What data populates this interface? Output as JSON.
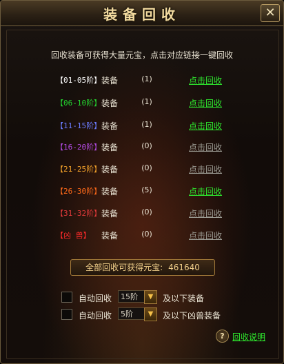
{
  "title": "装备回收",
  "close_icon": "close-x-icon",
  "intro": "回收装备可获得大量元宝，点击对应链接一键回收",
  "tier_word": "装备",
  "rows": [
    {
      "tier": "【01-05阶】",
      "tier_color": "#ffffff",
      "count": "(1)",
      "link": "点击回收",
      "active": true
    },
    {
      "tier": "【06-10阶】",
      "tier_color": "#23d12e",
      "count": "(1)",
      "link": "点击回收",
      "active": true
    },
    {
      "tier": "【11-15阶】",
      "tier_color": "#6b7cff",
      "count": "(1)",
      "link": "点击回收",
      "active": true
    },
    {
      "tier": "【16-20阶】",
      "tier_color": "#b04ae0",
      "count": "(0)",
      "link": "点击回收",
      "active": false
    },
    {
      "tier": "【21-25阶】",
      "tier_color": "#f0a02a",
      "count": "(0)",
      "link": "点击回收",
      "active": false
    },
    {
      "tier": "【26-30阶】",
      "tier_color": "#ff6a1a",
      "count": "(5)",
      "link": "点击回收",
      "active": true
    },
    {
      "tier": "【31-32阶】",
      "tier_color": "#e23a3a",
      "count": "(0)",
      "link": "点击回收",
      "active": false
    },
    {
      "tier": "【凶  兽】",
      "tier_color": "#ff2a2a",
      "count": "(0)",
      "link": "点击回收",
      "active": false
    }
  ],
  "total": {
    "label": "全部回收可获得元宝:",
    "value": "461640"
  },
  "options": [
    {
      "label": "自动回收",
      "select_value": "15阶",
      "suffix": "及以下装备",
      "checked": false
    },
    {
      "label": "自动回收",
      "select_value": "5阶",
      "suffix": "及以下凶兽装备",
      "checked": false
    }
  ],
  "help": {
    "icon": "question-mark-icon",
    "label": "回收说明"
  },
  "colors": {
    "link_active": "#2ee82e",
    "link_inactive": "#9a9a92",
    "title": "#f3dba0"
  }
}
